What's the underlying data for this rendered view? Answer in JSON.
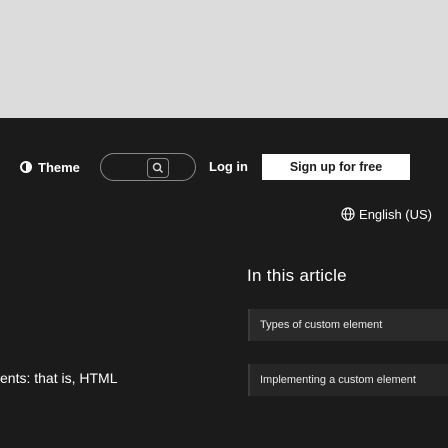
{
  "header": {
    "theme_label": "Theme",
    "search_shortcut": "/",
    "login_label": "Log in",
    "signup_label": "Sign up for free"
  },
  "language": {
    "label": "English (US)"
  },
  "toc": {
    "title": "In this article",
    "items": [
      {
        "label": "Types of custom element"
      },
      {
        "label": "Implementing a custom element"
      }
    ]
  },
  "content": {
    "text": "ents: that is, HTML"
  },
  "colors": {
    "background": "#1b1b1b",
    "top_band": "#dcdcdc",
    "accent": "#ffffff"
  }
}
